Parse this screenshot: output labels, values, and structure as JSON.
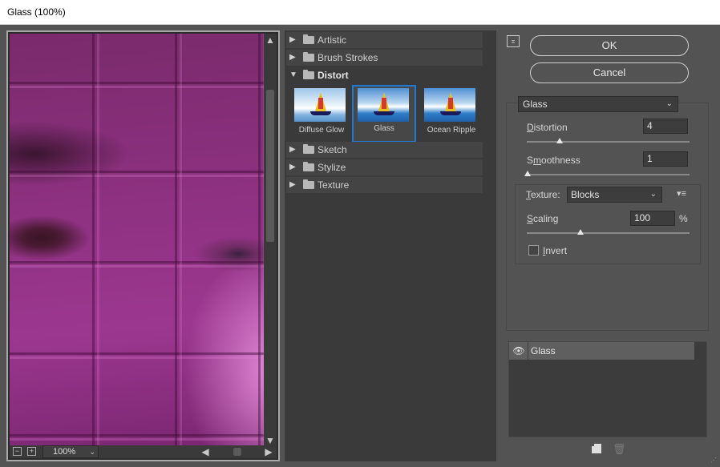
{
  "window": {
    "title": "Glass (100%)"
  },
  "preview": {
    "zoom_value": "100%",
    "zoom_out_symbol": "−",
    "zoom_in_symbol": "+",
    "scroll_up": "▲",
    "scroll_down": "▼",
    "scroll_left": "◀",
    "scroll_right": "▶",
    "zoom_chevron": "⌄"
  },
  "gallery": {
    "categories": [
      {
        "label": "Artistic",
        "open": false
      },
      {
        "label": "Brush Strokes",
        "open": false
      },
      {
        "label": "Distort",
        "open": true
      },
      {
        "label": "Sketch",
        "open": false
      },
      {
        "label": "Stylize",
        "open": false
      },
      {
        "label": "Texture",
        "open": false
      }
    ],
    "closed_triangle": "▶",
    "open_triangle": "▼",
    "distort_filters": [
      {
        "label": "Diffuse Glow",
        "selected": false
      },
      {
        "label": "Glass",
        "selected": true
      },
      {
        "label": "Ocean Ripple",
        "selected": false
      }
    ]
  },
  "buttons": {
    "ok": "OK",
    "cancel": "Cancel",
    "collapse_symbol": "⌅"
  },
  "settings": {
    "filter_selected": "Glass",
    "distortion": {
      "label_u": "D",
      "label_rest": "istortion",
      "value": "4",
      "slider_fraction": 0.2
    },
    "smoothness": {
      "label_pre": "S",
      "label_u": "m",
      "label_rest": "oothness",
      "value": "1",
      "slider_fraction": 0.0
    },
    "texture": {
      "label_u": "T",
      "label_rest": "exture:",
      "selected": "Blocks",
      "menu_symbol": "▾≡"
    },
    "scaling": {
      "label_u": "S",
      "label_rest": "caling",
      "value": "100",
      "unit": "%",
      "slider_fraction": 0.33
    },
    "invert": {
      "label_u": "I",
      "label_rest": "nvert",
      "checked": false
    },
    "chevron": "⌄"
  },
  "layers": {
    "items": [
      {
        "label": "Glass",
        "visible": true
      }
    ],
    "eye_symbol": "👁",
    "trash_symbol": "🗑"
  },
  "resize_grip": "⋰"
}
